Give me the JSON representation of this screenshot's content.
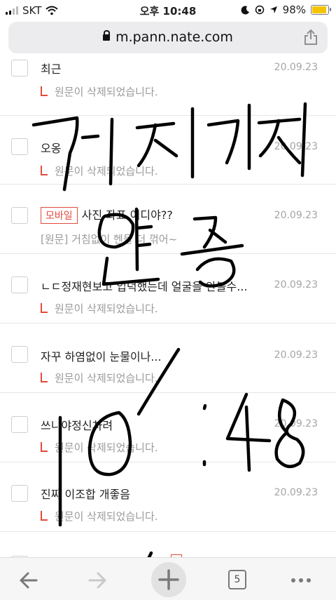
{
  "status_bar": {
    "carrier": "SKT",
    "time": "오후 10:48",
    "battery": "98%",
    "battery_level": 0.98
  },
  "url_bar": {
    "host": "m.pann.nate.com"
  },
  "items": [
    {
      "title": "최근",
      "date": "20.09.23",
      "reply": "원문이 삭제되었습니다."
    },
    {
      "title": "오옹",
      "date": "20.09.23",
      "reply": "원문이 삭제되었습니다."
    },
    {
      "badge": "모바일",
      "title": "사진 좌표 어디야??",
      "date": "20.09.23",
      "reply_prefix": "[원문]",
      "reply": "거침없이 헨들 더 꺾어~"
    },
    {
      "title": "ㄴㄷ정재현보고 입덕했는데 얼굴을 안볼수...",
      "date": "20.09.23",
      "reply": "원문이 삭제되었습니다."
    },
    {
      "title": "자꾸 하염없이 눈물이나...",
      "date": "20.09.23",
      "reply": "원문이 삭제되었습니다."
    },
    {
      "title": "쓰니야정신차려",
      "date": "20.09.23",
      "reply": "원문이 삭제되었습니다."
    },
    {
      "title": "진짜 이조합 개좋음",
      "date": "20.09.23",
      "reply": "원문이 삭제되었습니다."
    }
  ],
  "toolbar": {
    "tab_count": "5",
    "icons": [
      "back-arrow-icon",
      "forward-arrow-icon",
      "new-tab-plus-icon",
      "tabs-icon",
      "more-icon"
    ]
  },
  "colors": {
    "accent": "#e34a3c",
    "muted": "#a5a5a5",
    "battery": "#f5c400"
  }
}
